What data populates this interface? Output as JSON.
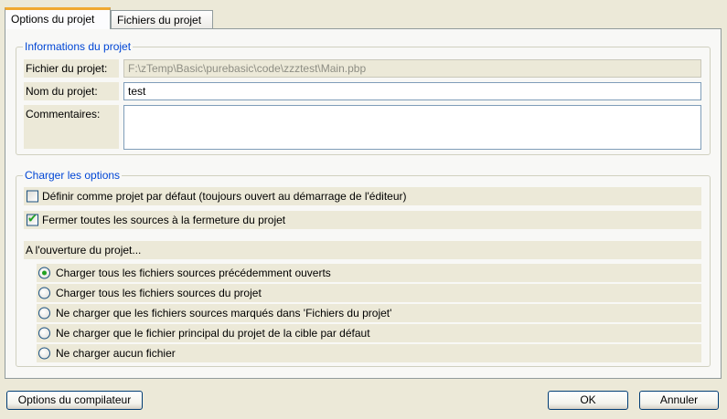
{
  "tabs": [
    {
      "label": "Options du projet",
      "active": true
    },
    {
      "label": "Fichiers du projet",
      "active": false
    }
  ],
  "info_group": {
    "legend": "Informations du projet",
    "file_label": "Fichier du projet:",
    "file_value": "F:\\zTemp\\Basic\\purebasic\\code\\zzztest\\Main.pbp",
    "name_label": "Nom du projet:",
    "name_value": "test",
    "comments_label": "Commentaires:",
    "comments_value": ""
  },
  "load_group": {
    "legend": "Charger les options",
    "checkboxes": [
      {
        "label": "Définir comme projet par défaut (toujours ouvert au démarrage de l'éditeur)",
        "checked": false
      },
      {
        "label": "Fermer toutes les sources à la fermeture du projet",
        "checked": true
      }
    ],
    "on_open_label": "A l'ouverture du projet...",
    "radios": [
      {
        "label": "Charger tous les fichiers sources précédemment ouverts",
        "selected": true
      },
      {
        "label": "Charger tous les fichiers sources du projet",
        "selected": false
      },
      {
        "label": "Ne charger que les fichiers sources marqués dans 'Fichiers du projet'",
        "selected": false
      },
      {
        "label": "Ne charger que le fichier principal du projet de la cible par défaut",
        "selected": false
      },
      {
        "label": "Ne charger aucun fichier",
        "selected": false
      }
    ]
  },
  "buttons": {
    "compiler_options": "Options du compilateur",
    "ok": "OK",
    "cancel": "Annuler"
  },
  "colors": {
    "window_bg": "#ece9d8",
    "panel_bg": "#f8f8f6",
    "legend_text": "#0046d5",
    "active_tab_accent": "#f0a830",
    "check_mark": "#21a121"
  }
}
